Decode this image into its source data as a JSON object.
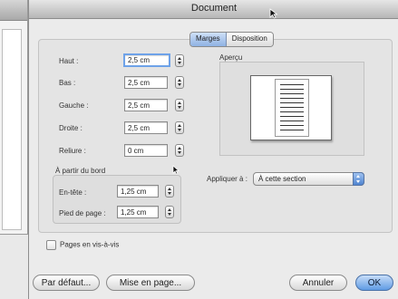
{
  "window": {
    "title": "Document"
  },
  "tabs": [
    {
      "label": "Marges",
      "active": true
    },
    {
      "label": "Disposition",
      "active": false
    }
  ],
  "margins": {
    "top": {
      "label": "Haut :",
      "value": "2,5 cm"
    },
    "bottom": {
      "label": "Bas :",
      "value": "2,5 cm"
    },
    "left": {
      "label": "Gauche :",
      "value": "2,5 cm"
    },
    "right": {
      "label": "Droite :",
      "value": "2,5 cm"
    },
    "gutter": {
      "label": "Reliure :",
      "value": "0 cm"
    }
  },
  "from_edge": {
    "title": "À partir du bord",
    "header": {
      "label": "En-tête :",
      "value": "1,25 cm"
    },
    "footer": {
      "label": "Pied de page :",
      "value": "1,25 cm"
    }
  },
  "preview": {
    "label": "Aperçu"
  },
  "apply": {
    "label": "Appliquer à :",
    "value": "À cette section"
  },
  "mirror": {
    "label": "Pages en vis-à-vis",
    "checked": false
  },
  "buttons": {
    "defaults": "Par défaut...",
    "page_setup": "Mise en page...",
    "cancel": "Annuler",
    "ok": "OK"
  },
  "colors": {
    "accent": "#5f9be4",
    "focus": "#6ea2e8"
  }
}
